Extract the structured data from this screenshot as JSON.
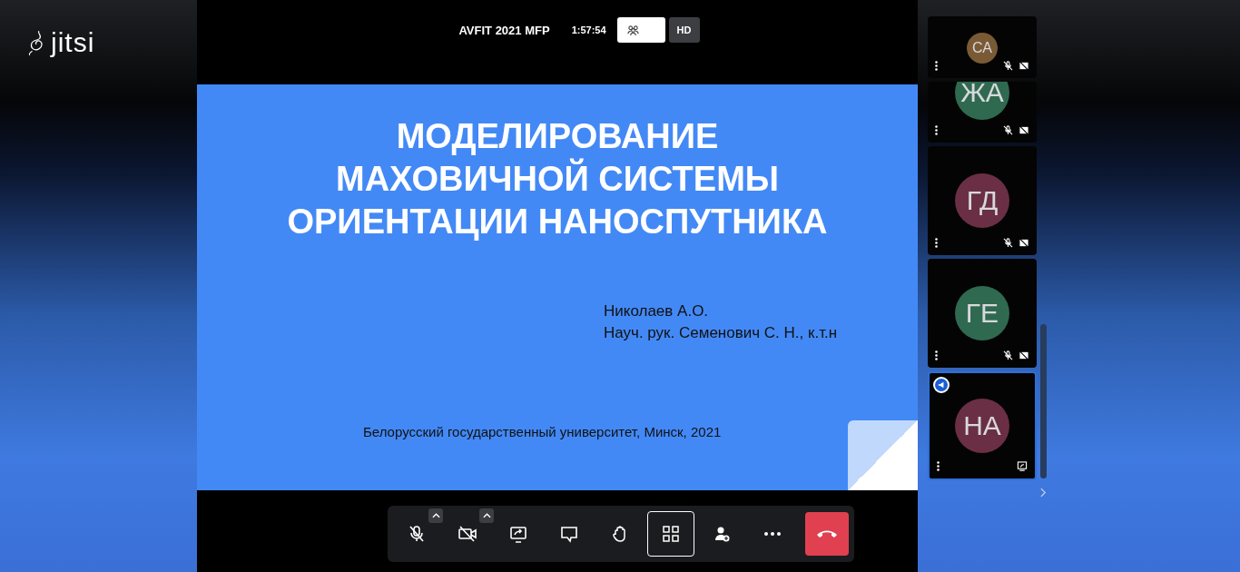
{
  "logo": {
    "text": "jitsi"
  },
  "header": {
    "meeting_name": "AVFIT 2021 MFP",
    "timer": "1:57:54",
    "quality": "HD"
  },
  "slide": {
    "title_lines": [
      "МОДЕЛИРОВАНИЕ",
      "МАХОВИЧНОЙ СИСТЕМЫ",
      "ОРИЕНТАЦИИ НАНОСПУТНИКА"
    ],
    "authors": [
      "Николаев А.О.",
      "Науч. рук. Семенович С. Н., к.т.н"
    ],
    "footer": "Белорусский государственный университет, Минск, 2021"
  },
  "toolbar": [
    {
      "kind": "mic",
      "muted": true,
      "has_menu": true,
      "selected": false
    },
    {
      "kind": "camera",
      "muted": true,
      "has_menu": true,
      "selected": false
    },
    {
      "kind": "share",
      "has_menu": false,
      "selected": false
    },
    {
      "kind": "chat",
      "has_menu": false,
      "selected": false
    },
    {
      "kind": "hand",
      "has_menu": false,
      "selected": false
    },
    {
      "kind": "tiles",
      "has_menu": false,
      "selected": true
    },
    {
      "kind": "invite",
      "has_menu": false,
      "selected": false
    },
    {
      "kind": "more",
      "has_menu": false,
      "selected": false
    },
    {
      "kind": "hangup",
      "has_menu": false,
      "selected": false
    }
  ],
  "participants": [
    {
      "kind": "local",
      "initials": "СА",
      "color": "#7a5a35",
      "audio_muted": true,
      "video_muted": true,
      "sharing_screen": false,
      "speaking": false,
      "selected": false
    },
    {
      "kind": "partial",
      "initials": "ЖА",
      "color": "#2f6a50",
      "audio_muted": true,
      "video_muted": true,
      "sharing_screen": false,
      "speaking": false,
      "selected": false
    },
    {
      "kind": "full",
      "initials": "ГД",
      "color": "#6a2f45",
      "audio_muted": true,
      "video_muted": true,
      "sharing_screen": false,
      "speaking": false,
      "selected": false
    },
    {
      "kind": "full",
      "initials": "ГЕ",
      "color": "#2f6a50",
      "audio_muted": true,
      "video_muted": true,
      "sharing_screen": false,
      "speaking": false,
      "selected": false
    },
    {
      "kind": "full",
      "initials": "НА",
      "color": "#6a2f45",
      "audio_muted": false,
      "video_muted": false,
      "sharing_screen": true,
      "speaking": true,
      "selected": true
    }
  ]
}
